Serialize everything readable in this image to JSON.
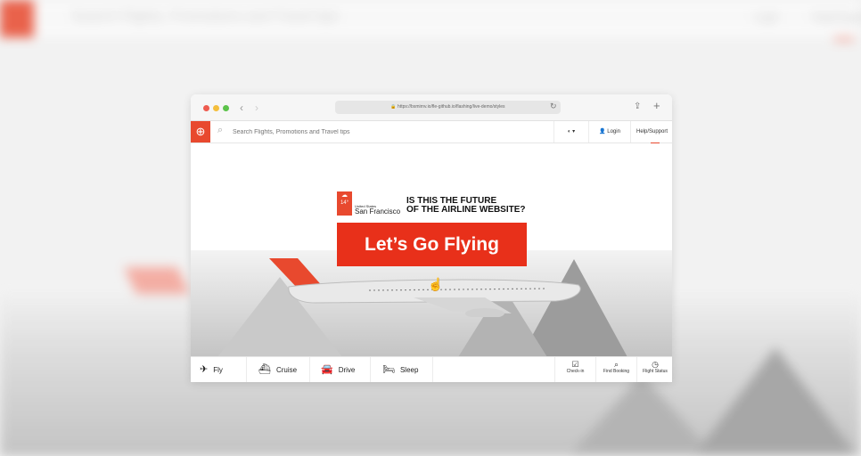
{
  "background": {
    "search_placeholder": "Search Flights, Promotions and Travel tips",
    "login_label": "Login",
    "help_label": "Help/Support"
  },
  "browser": {
    "url": "https://bsmirnv.io/fle-github.io/flashing/live-demo/styles",
    "back_icon": "chevron-left-icon",
    "forward_icon": "chevron-right-icon"
  },
  "header": {
    "search_placeholder": "Search Flights, Promotions and Travel tips",
    "login_label": "Login",
    "help_label": "Help/Support"
  },
  "hero": {
    "weather_temp": "14°",
    "location_country": "United States",
    "location_city": "San Francisco",
    "tagline_line1": "IS THIS THE FUTURE",
    "tagline_line2": "OF THE AIRLINE WEBSITE?",
    "cta_label": "Let’s Go Flying"
  },
  "bottom_nav": {
    "items": [
      {
        "label": "Fly",
        "icon": "plane-icon"
      },
      {
        "label": "Cruise",
        "icon": "ship-icon"
      },
      {
        "label": "Drive",
        "icon": "car-icon"
      },
      {
        "label": "Sleep",
        "icon": "bed-icon"
      }
    ],
    "actions": [
      {
        "label": "Check-in",
        "icon": "checkbox-icon"
      },
      {
        "label": "Find Booking",
        "icon": "search-icon"
      },
      {
        "label": "Flight Status",
        "icon": "clock-icon"
      }
    ]
  },
  "colors": {
    "brand": "#e8492e",
    "cta": "#e8301a"
  }
}
